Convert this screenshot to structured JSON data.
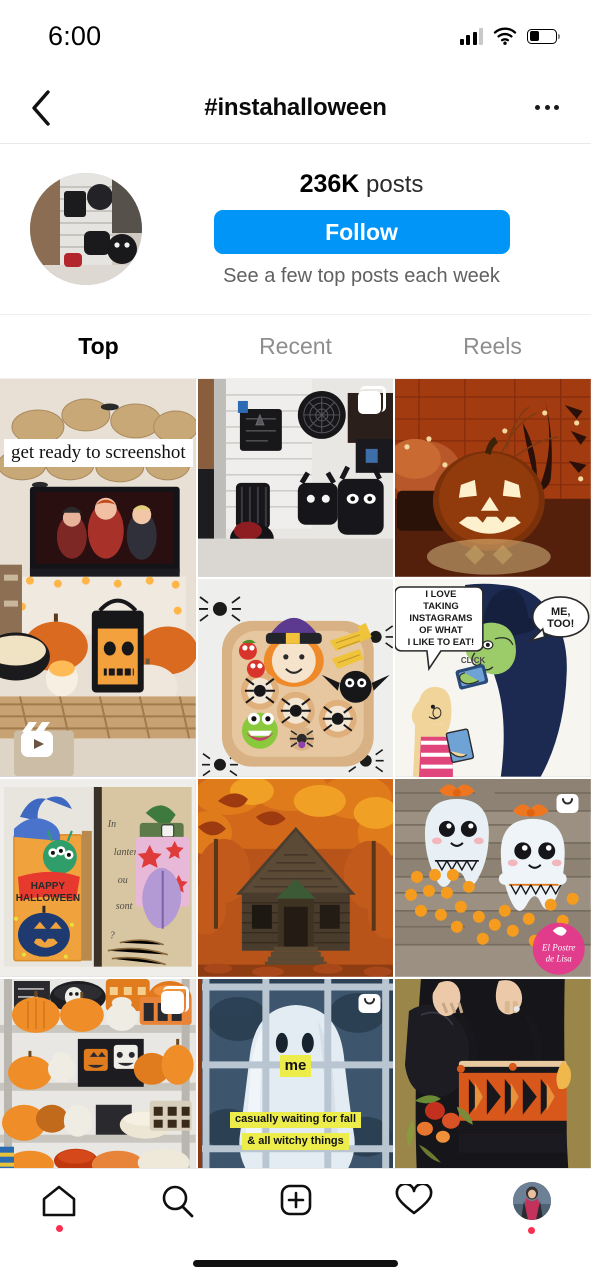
{
  "status_bar": {
    "time": "6:00",
    "signal_icon": "signal-bars-icon",
    "wifi_icon": "wifi-icon",
    "battery_icon": "battery-icon",
    "battery_level_pct": 38
  },
  "header": {
    "back_icon": "chevron-left-icon",
    "title": "#instahalloween",
    "more_icon": "more-options-icon"
  },
  "profile": {
    "avatar_alt": "hashtag-avatar",
    "post_count": "236K",
    "post_count_label": "posts",
    "follow_label": "Follow",
    "follow_color": "#0095f6",
    "note": "See a few top posts each week"
  },
  "tabs": [
    {
      "label": "Top",
      "active": true
    },
    {
      "label": "Recent",
      "active": false
    },
    {
      "label": "Reels",
      "active": false
    }
  ],
  "grid": {
    "posts": [
      {
        "id": "post-reel-screenshot",
        "alt": "halloween-living-room-with-hocus-pocus-on-tv",
        "badge": "reels-icon",
        "overlay_text": "get ready to screenshot",
        "span": "tall"
      },
      {
        "id": "post-bag-display",
        "alt": "store-rack-of-halloween-bags-and-cat-backpacks",
        "badge": "carousel-icon",
        "overlay_text": "",
        "span": "single"
      },
      {
        "id": "post-jack-o-lantern",
        "alt": "glowing-jack-o-lantern-against-orange-brick-wall",
        "badge": "none",
        "overlay_text": "",
        "span": "single"
      },
      {
        "id": "post-witch-food-platter",
        "alt": "halloween-witch-food-platter-with-spider-pizzas",
        "badge": "none",
        "overlay_text": "",
        "span": "single"
      },
      {
        "id": "post-witch-cartoon",
        "alt": "cartoon-girl-and-witch-with-phones",
        "badge": "none",
        "overlay_text": "",
        "span": "single",
        "cartoon": {
          "girl_bubble": "I LOVE TAKING INSTAGRAMS OF WHAT I LIKE TO EAT!",
          "sound_word": "CLICK",
          "witch_bubble": "ME, TOO!"
        }
      },
      {
        "id": "post-craft-book",
        "alt": "handmade-halloween-craft-card-with-bat-and-pumpkin",
        "badge": "none",
        "overlay_text": "",
        "span": "single",
        "card_text": "HAPPY HALLOWEEN"
      },
      {
        "id": "post-autumn-cabin",
        "alt": "old-wooden-cabin-in-orange-autumn-forest",
        "badge": "none",
        "overlay_text": "",
        "span": "single"
      },
      {
        "id": "post-ghost-cookies",
        "alt": "two-ghost-cookies-with-orange-bows-on-wood",
        "badge": "shopping-bag-icon",
        "overlay_text": "",
        "span": "single",
        "watermark": "El Postre de Lisa"
      },
      {
        "id": "post-pumpkin-shelf",
        "alt": "store-shelves-of-orange-pumpkin-ceramics",
        "badge": "carousel-icon",
        "overlay_text": "",
        "span": "single"
      },
      {
        "id": "post-ghost-window",
        "alt": "sheet-ghost-behind-window-meme",
        "badge": "shopping-bag-icon",
        "span": "single",
        "meme": {
          "line1": "me",
          "line2": "casually waiting for fall",
          "line3": "& all witchy things"
        }
      },
      {
        "id": "post-tote-bag",
        "alt": "hands-holding-orange-aztec-tote-bag-with-flowers",
        "badge": "none",
        "overlay_text": "",
        "span": "single"
      }
    ]
  },
  "bottom_nav": {
    "items": [
      {
        "name": "home",
        "icon": "home-icon",
        "badge_dot": true
      },
      {
        "name": "search",
        "icon": "search-icon",
        "badge_dot": false
      },
      {
        "name": "create",
        "icon": "plus-square-icon",
        "badge_dot": false
      },
      {
        "name": "activity",
        "icon": "heart-icon",
        "badge_dot": false
      },
      {
        "name": "profile",
        "icon": "profile-avatar",
        "badge_dot": true
      }
    ]
  },
  "home_indicator": "home-indicator-bar"
}
